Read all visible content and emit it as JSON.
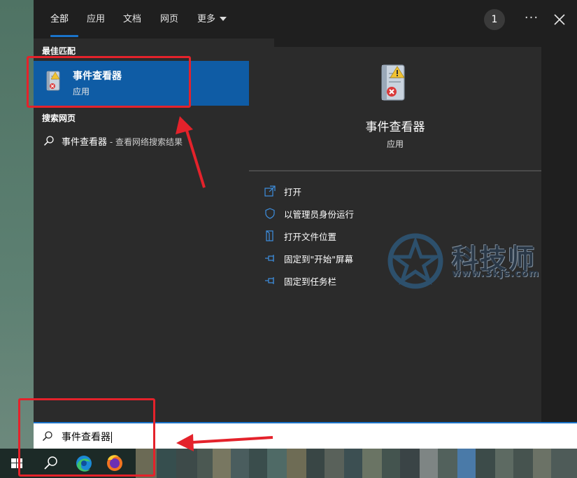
{
  "tabs": [
    {
      "label": "全部"
    },
    {
      "label": "应用"
    },
    {
      "label": "文档"
    },
    {
      "label": "网页"
    },
    {
      "label": "更多"
    }
  ],
  "header": {
    "badge": "1",
    "more_label": "···"
  },
  "left": {
    "best_match_title": "最佳匹配",
    "best_match": {
      "name": "事件查看器",
      "type": "应用"
    },
    "web_title": "搜索网页",
    "web_result": {
      "main": "事件查看器",
      "sub": " - 查看网络搜索结果"
    }
  },
  "right": {
    "app_name": "事件查看器",
    "app_type": "应用",
    "actions": [
      {
        "label": "打开",
        "icon": "open-icon"
      },
      {
        "label": "以管理员身份运行",
        "icon": "shield-icon"
      },
      {
        "label": "打开文件位置",
        "icon": "folder-icon"
      },
      {
        "label": "固定到\"开始\"屏幕",
        "icon": "pin-icon"
      },
      {
        "label": "固定到任务栏",
        "icon": "pin-icon"
      }
    ]
  },
  "search": {
    "value": "事件查看器"
  },
  "watermark": {
    "title": "科技师",
    "url": "www.3kjs.com"
  },
  "colors": {
    "accent": "#1a73c9",
    "highlight": "#0f5ca5",
    "annotation": "#e4222b",
    "panel": "#2b2b2b"
  },
  "taskbar_icons": [
    "windows-start-icon",
    "search-icon",
    "edge-icon",
    "firefox-icon"
  ]
}
